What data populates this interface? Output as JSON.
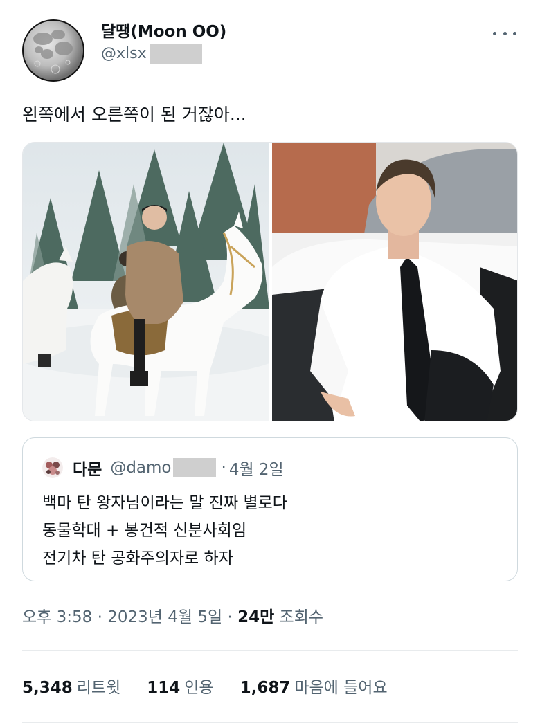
{
  "author": {
    "display_name": "달땡(Moon OO)",
    "handle_visible": "@xlsx",
    "avatar_icon": "moon-avatar"
  },
  "tweet": {
    "text": "왼쪽에서 오른쪽이 된 거잖아..."
  },
  "quote": {
    "author_name": "다문",
    "handle_visible": "@damo",
    "separator": "·",
    "date": "4월 2일",
    "lines": [
      "백마 탄 왕자님이라는 말 진짜 별로다",
      "동물학대 + 봉건적 신분사회임",
      "전기차 탄 공화주의자로 하자"
    ]
  },
  "meta": {
    "time": "오후 3:58",
    "separator": "·",
    "date": "2023년 4월 5일",
    "views_count": "24만",
    "views_label": "조회수"
  },
  "stats": {
    "retweets_count": "5,348",
    "retweets_label": "리트윗",
    "quotes_count": "114",
    "quotes_label": "인용",
    "likes_count": "1,687",
    "likes_label": "마음에 들어요"
  },
  "colors": {
    "text_primary": "#0f1419",
    "text_secondary": "#536471",
    "border": "#cfd9de",
    "redaction": "#cfcfcf"
  }
}
